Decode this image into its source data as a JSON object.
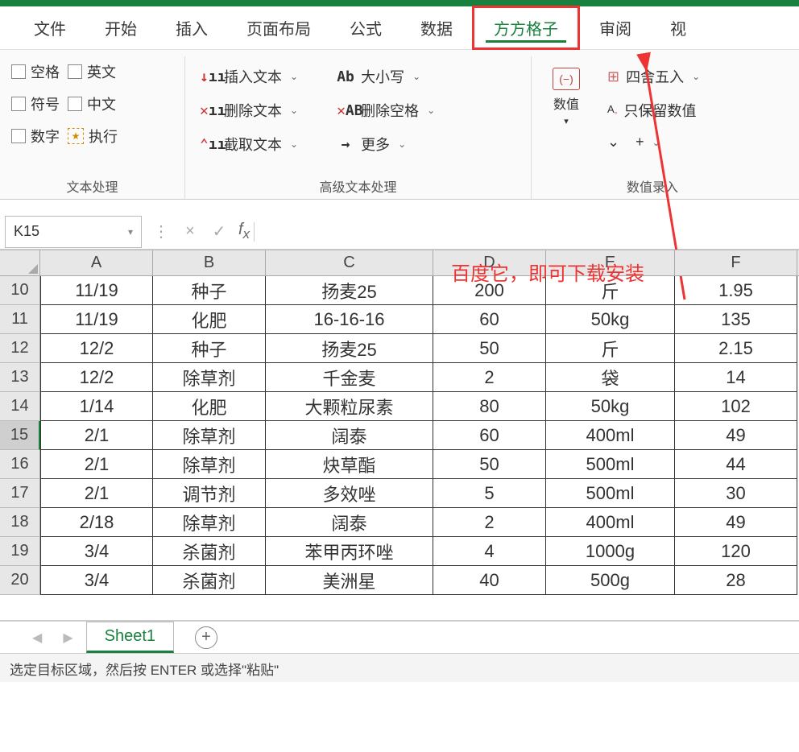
{
  "tabs": [
    "文件",
    "开始",
    "插入",
    "页面布局",
    "公式",
    "数据",
    "方方格子",
    "审阅",
    "视"
  ],
  "active_tab_index": 6,
  "ribbon": {
    "group1": {
      "label": "文本处理",
      "checks": [
        [
          "空格",
          "英文"
        ],
        [
          "符号",
          "中文"
        ],
        [
          "数字",
          "执行"
        ]
      ]
    },
    "group2": {
      "label": "高级文本处理",
      "col1": [
        "插入文本",
        "删除文本",
        "截取文本"
      ],
      "col2": [
        "大小写",
        "删除空格",
        "更多"
      ]
    },
    "group3": {
      "label": "数值录入",
      "numeric": "数值",
      "right": [
        "四舍五入",
        "只保留数值"
      ]
    }
  },
  "namebox": "K15",
  "columns": [
    "A",
    "B",
    "C",
    "D",
    "E",
    "F"
  ],
  "col_widths": [
    "colA",
    "colB",
    "colC",
    "colD",
    "colE",
    "colF"
  ],
  "row_start": 10,
  "selected_row": 15,
  "rows": [
    [
      "11/19",
      "种子",
      "扬麦25",
      "200",
      "斤",
      "1.95"
    ],
    [
      "11/19",
      "化肥",
      "16-16-16",
      "60",
      "50kg",
      "135"
    ],
    [
      "12/2",
      "种子",
      "扬麦25",
      "50",
      "斤",
      "2.15"
    ],
    [
      "12/2",
      "除草剂",
      "千金麦",
      "2",
      "袋",
      "14"
    ],
    [
      "1/14",
      "化肥",
      "大颗粒尿素",
      "80",
      "50kg",
      "102"
    ],
    [
      "2/1",
      "除草剂",
      "阔泰",
      "60",
      "400ml",
      "49"
    ],
    [
      "2/1",
      "除草剂",
      "炔草酯",
      "50",
      "500ml",
      "44"
    ],
    [
      "2/1",
      "调节剂",
      "多效唑",
      "5",
      "500ml",
      "30"
    ],
    [
      "2/18",
      "除草剂",
      "阔泰",
      "2",
      "400ml",
      "49"
    ],
    [
      "3/4",
      "杀菌剂",
      "苯甲丙环唑",
      "4",
      "1000g",
      "120"
    ],
    [
      "3/4",
      "杀菌剂",
      "美洲星",
      "40",
      "500g",
      "28"
    ]
  ],
  "sheet_name": "Sheet1",
  "status_text": "选定目标区域，然后按 ENTER 或选择\"粘贴\"",
  "annotation": "百度它，即可下载安装"
}
